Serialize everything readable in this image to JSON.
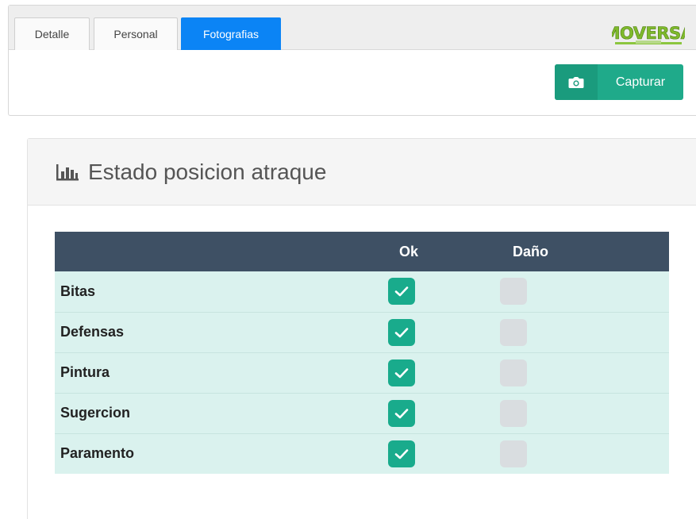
{
  "tabs": [
    {
      "label": "Detalle",
      "active": false
    },
    {
      "label": "Personal",
      "active": false
    },
    {
      "label": "Fotografias",
      "active": true
    }
  ],
  "logo": {
    "text": "MOVERSA"
  },
  "capture_button": {
    "label": "Capturar",
    "icon": "camera-icon"
  },
  "card": {
    "title": "Estado posicion atraque",
    "title_icon": "bar-chart-icon"
  },
  "table": {
    "headers": [
      "",
      "Ok",
      "Daño"
    ],
    "rows": [
      {
        "label": "Bitas",
        "ok": true,
        "dano": false
      },
      {
        "label": "Defensas",
        "ok": true,
        "dano": false
      },
      {
        "label": "Pintura",
        "ok": true,
        "dano": false
      },
      {
        "label": "Sugercion",
        "ok": true,
        "dano": false
      },
      {
        "label": "Paramento",
        "ok": true,
        "dano": false
      }
    ]
  },
  "colors": {
    "accent_blue": "#0b84f5",
    "accent_green": "#1faa8a",
    "header_dark": "#3e5064",
    "row_bg": "#daf2ee",
    "checkbox_checked": "#19ab8c",
    "checkbox_unchecked": "#d9dde0"
  }
}
